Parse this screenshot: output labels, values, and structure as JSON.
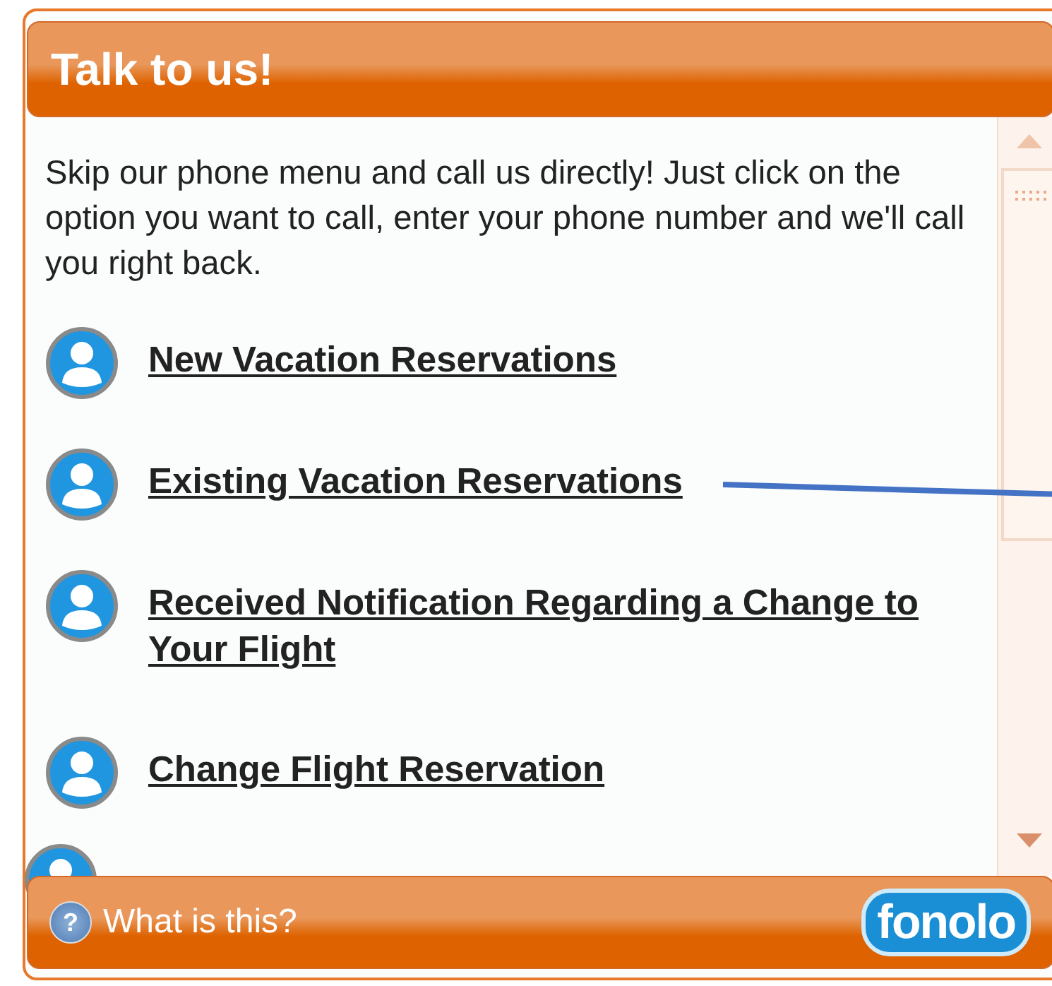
{
  "header": {
    "title": "Talk to us!"
  },
  "intro": "Skip our phone menu and call us directly! Just click on the option you want to call, enter your phone number and we'll call you right back.",
  "options": [
    {
      "label": "New Vacation Reservations"
    },
    {
      "label": "Existing Vacation Reservations"
    },
    {
      "label": "Received Notification Regarding a Change to Your Flight"
    },
    {
      "label": "Change Flight Reservation"
    }
  ],
  "footer": {
    "help_icon": "?",
    "link": "What is this?",
    "logo": "fonolo"
  }
}
